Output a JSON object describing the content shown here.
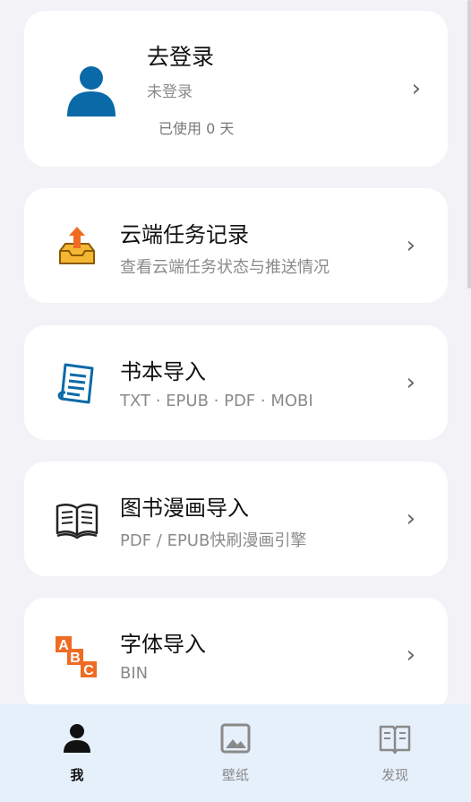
{
  "login": {
    "title": "去登录",
    "status": "未登录",
    "usage_prefix": "已使用",
    "days_used": "0",
    "usage_suffix": "天"
  },
  "features": [
    {
      "title": "云端任务记录",
      "subtitle": "查看云端任务状态与推送情况",
      "icon": "cloud-upload-tray-icon"
    },
    {
      "title": "书本导入",
      "subtitle": "TXT · EPUB · PDF · MOBI",
      "icon": "document-icon"
    },
    {
      "title": "图书漫画导入",
      "subtitle": "PDF / EPUB快刷漫画引擎",
      "icon": "open-book-icon"
    },
    {
      "title": "字体导入",
      "subtitle": "BIN",
      "icon": "abc-font-icon"
    }
  ],
  "tabs": [
    {
      "label": "我",
      "icon": "person-icon",
      "active": true
    },
    {
      "label": "壁纸",
      "icon": "image-icon",
      "active": false
    },
    {
      "label": "发现",
      "icon": "book-icon",
      "active": false
    }
  ],
  "colors": {
    "avatar": "#0a6aa8",
    "upload_arrow": "#ef6b22",
    "tray": "#f5b733",
    "doc": "#0a6aa8",
    "font_icon": "#ef6b22",
    "tabbar_bg": "#e5f0fb"
  },
  "chevron": "›"
}
